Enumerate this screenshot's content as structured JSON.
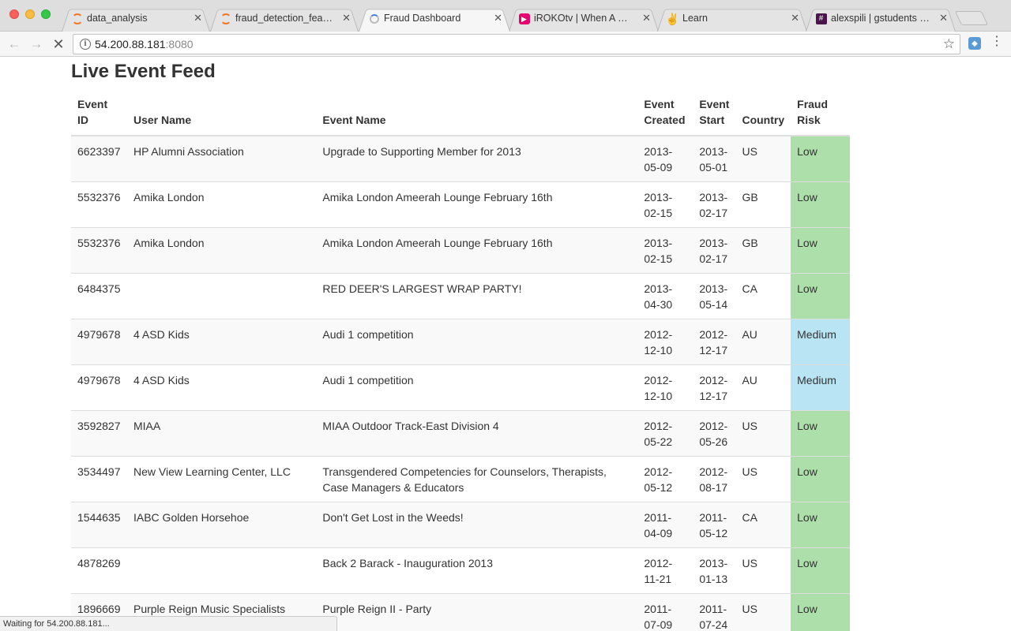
{
  "tabs": [
    {
      "title": "data_analysis",
      "icon": "jupyter-icon"
    },
    {
      "title": "fraud_detection_features",
      "icon": "jupyter-icon"
    },
    {
      "title": "Fraud Dashboard",
      "icon": "loading-spinner-icon"
    },
    {
      "title": "iROKOtv | When A Woman",
      "icon": "iroko-icon"
    },
    {
      "title": "Learn",
      "icon": "hand-icon"
    },
    {
      "title": "alexspili | gstudents Slack",
      "icon": "slack-icon"
    }
  ],
  "toolbar": {
    "url_host": "54.200.88.181",
    "url_port": ":8080"
  },
  "page": {
    "title": "Live Event Feed"
  },
  "table": {
    "headers": {
      "event_id": [
        "Event",
        "ID"
      ],
      "user_name": "User Name",
      "event_name": "Event Name",
      "event_created": [
        "Event",
        "Created"
      ],
      "event_start": [
        "Event",
        "Start"
      ],
      "country": "Country",
      "fraud_risk": [
        "Fraud",
        "Risk"
      ]
    },
    "rows": [
      {
        "id": "6623397",
        "user": "HP Alumni Association",
        "event": "Upgrade to Supporting Member for 2013",
        "created": [
          "2013-",
          "05-09"
        ],
        "start": [
          "2013-",
          "05-01"
        ],
        "country": "US",
        "risk": "Low"
      },
      {
        "id": "5532376",
        "user": "Amika London",
        "event": "Amika London Ameerah Lounge February 16th",
        "created": [
          "2013-",
          "02-15"
        ],
        "start": [
          "2013-",
          "02-17"
        ],
        "country": "GB",
        "risk": "Low"
      },
      {
        "id": "5532376",
        "user": "Amika London",
        "event": "Amika London Ameerah Lounge February 16th",
        "created": [
          "2013-",
          "02-15"
        ],
        "start": [
          "2013-",
          "02-17"
        ],
        "country": "GB",
        "risk": "Low"
      },
      {
        "id": "6484375",
        "user": "",
        "event": "RED DEER'S LARGEST WRAP PARTY!",
        "created": [
          "2013-",
          "04-30"
        ],
        "start": [
          "2013-",
          "05-14"
        ],
        "country": "CA",
        "risk": "Low"
      },
      {
        "id": "4979678",
        "user": "4 ASD Kids",
        "event": "Audi 1 competition",
        "created": [
          "2012-",
          "12-10"
        ],
        "start": [
          "2012-",
          "12-17"
        ],
        "country": "AU",
        "risk": "Medium"
      },
      {
        "id": "4979678",
        "user": "4 ASD Kids",
        "event": "Audi 1 competition",
        "created": [
          "2012-",
          "12-10"
        ],
        "start": [
          "2012-",
          "12-17"
        ],
        "country": "AU",
        "risk": "Medium"
      },
      {
        "id": "3592827",
        "user": "MIAA",
        "event": "MIAA Outdoor Track-East Division 4",
        "created": [
          "2012-",
          "05-22"
        ],
        "start": [
          "2012-",
          "05-26"
        ],
        "country": "US",
        "risk": "Low"
      },
      {
        "id": "3534497",
        "user": "New View Learning Center, LLC",
        "event": "Transgendered Competencies for Counselors, Therapists, Case Managers & Educators",
        "created": [
          "2012-",
          "05-12"
        ],
        "start": [
          "2012-",
          "08-17"
        ],
        "country": "US",
        "risk": "Low"
      },
      {
        "id": "1544635",
        "user": "IABC Golden Horsehoe",
        "event": "Don't Get Lost in the Weeds!",
        "created": [
          "2011-",
          "04-09"
        ],
        "start": [
          "2011-",
          "05-12"
        ],
        "country": "CA",
        "risk": "Low"
      },
      {
        "id": "4878269",
        "user": "",
        "event": "Back 2 Barack - Inauguration 2013",
        "created": [
          "2012-",
          "11-21"
        ],
        "start": [
          "2013-",
          "01-13"
        ],
        "country": "US",
        "risk": "Low"
      },
      {
        "id": "1896669",
        "user": "Purple Reign Music Specialists",
        "event": "Purple Reign II - Party",
        "created": [
          "2011-",
          "07-09"
        ],
        "start": [
          "2011-",
          "07-24"
        ],
        "country": "US",
        "risk": "Low"
      }
    ]
  },
  "status_bar": {
    "text": "Waiting for 54.200.88.181..."
  },
  "colors": {
    "risk_low": "#acdfa9",
    "risk_medium": "#b8e4f3"
  }
}
